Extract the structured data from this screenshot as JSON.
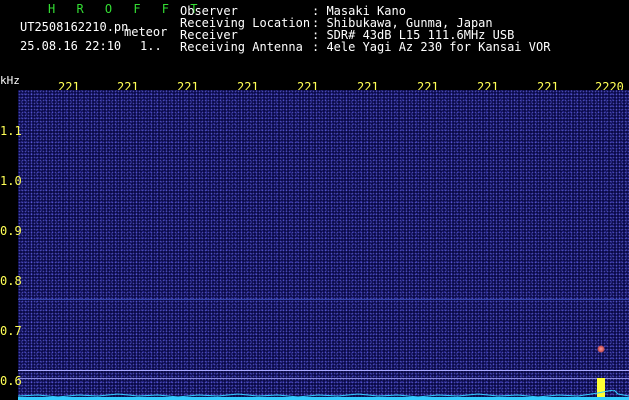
{
  "header": {
    "app_title": "H R O F F T",
    "filename": "UT2508162210.pn",
    "meteor_label": "meteor",
    "datetime": "25.08.16 22:10",
    "counter": "1..",
    "fields": [
      {
        "label": "Observer",
        "value": ": Masaki Kano"
      },
      {
        "label": "Receiving Location",
        "value": ": Shibukawa, Gunma, Japan"
      },
      {
        "label": "Receiver",
        "value": ": SDR# 43dB L15 111.6MHz USB"
      },
      {
        "label": "Receiving Antenna",
        "value": ": 4ele Yagi Az 230 for Kansai VOR"
      }
    ]
  },
  "axis": {
    "unit": "kHz",
    "top_ticks": [
      "221",
      "221",
      "221",
      "221",
      "221",
      "221",
      "221",
      "221",
      "221",
      "2220"
    ],
    "y_ticks": [
      "1.1",
      "1.0",
      "0.9",
      "0.8",
      "0.7",
      "0.6"
    ]
  },
  "colors": {
    "background": "#0b0b4a",
    "line": "#aaaaff",
    "spectrum": "#33ccff",
    "echo": "#ffff33"
  }
}
